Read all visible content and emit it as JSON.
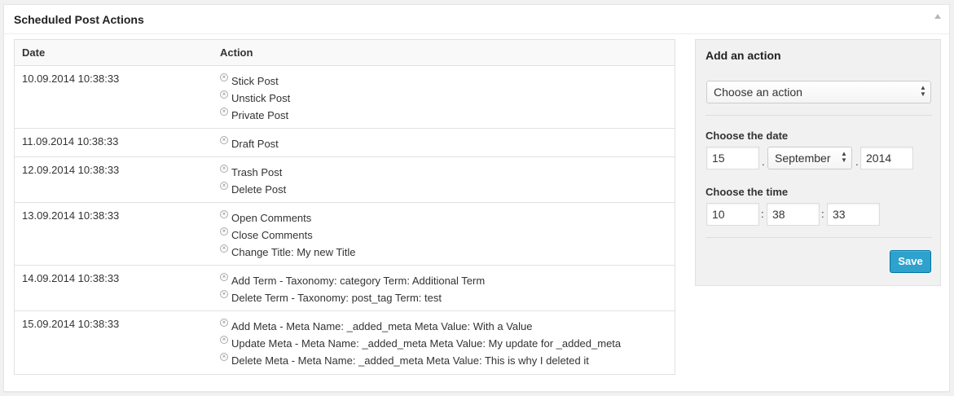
{
  "metabox": {
    "title": "Scheduled Post Actions"
  },
  "table": {
    "headers": {
      "date": "Date",
      "action": "Action"
    },
    "rows": [
      {
        "date": "10.09.2014 10:38:33",
        "actions": [
          "Stick Post",
          "Unstick Post",
          "Private Post"
        ]
      },
      {
        "date": "11.09.2014 10:38:33",
        "actions": [
          "Draft Post"
        ]
      },
      {
        "date": "12.09.2014 10:38:33",
        "actions": [
          "Trash Post",
          "Delete Post"
        ]
      },
      {
        "date": "13.09.2014 10:38:33",
        "actions": [
          "Open Comments",
          "Close Comments",
          "Change Title: My new Title"
        ]
      },
      {
        "date": "14.09.2014 10:38:33",
        "actions": [
          "Add Term - Taxonomy: category Term: Additional Term",
          "Delete Term - Taxonomy: post_tag Term: test"
        ]
      },
      {
        "date": "15.09.2014 10:38:33",
        "actions": [
          "Add Meta - Meta Name: _added_meta Meta Value: With a Value",
          "Update Meta - Meta Name: _added_meta Meta Value: My update for _added_meta",
          "Delete Meta - Meta Name: _added_meta Meta Value: This is why I deleted it"
        ]
      }
    ]
  },
  "add_action": {
    "title": "Add an action",
    "action_select": "Choose an action",
    "date_label": "Choose the date",
    "day": "15",
    "month": "September",
    "year": "2014",
    "date_separator": ".",
    "time_label": "Choose the time",
    "hour": "10",
    "minute": "38",
    "second": "33",
    "time_separator": ":",
    "save_label": "Save"
  },
  "colors": {
    "accent": "#2ea2cc",
    "panel_bg": "#f1f1f1"
  }
}
